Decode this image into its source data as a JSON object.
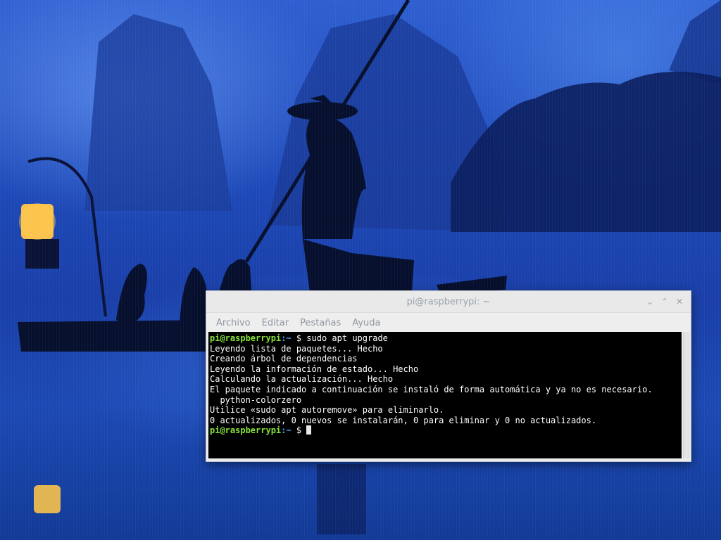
{
  "window": {
    "title": "pi@raspberrypi: ~",
    "controls": [
      "⌄",
      "⌃",
      "✕"
    ]
  },
  "menu": {
    "items": [
      "Archivo",
      "Editar",
      "Pestañas",
      "Ayuda"
    ]
  },
  "terminal": {
    "prompt_user": "pi@raspberrypi",
    "prompt_path": ":~",
    "prompt_symbol": " $ ",
    "command": "sudo apt upgrade",
    "output": [
      "Leyendo lista de paquetes... Hecho",
      "Creando árbol de dependencias",
      "Leyendo la información de estado... Hecho",
      "Calculando la actualización... Hecho",
      "El paquete indicado a continuación se instaló de forma automática y ya no es necesario.",
      "  python-colorzero",
      "Utilice «sudo apt autoremove» para eliminarlo.",
      "0 actualizados, 0 nuevos se instalarán, 0 para eliminar y 0 no actualizados."
    ]
  },
  "colors": {
    "prompt_user": "#87e33b",
    "prompt_path": "#4fa3ff",
    "terminal_bg": "#000000",
    "terminal_fg": "#ffffff"
  },
  "wallpaper": {
    "description_icons": [
      "fisherman-silhouette",
      "lantern",
      "cormorant-birds",
      "bamboo-raft"
    ]
  }
}
